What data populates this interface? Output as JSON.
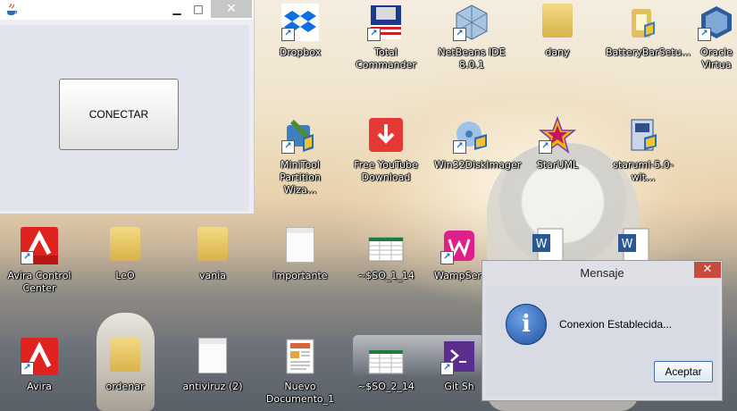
{
  "app_window": {
    "title": "",
    "connect_button": "CONECTAR",
    "controls": {
      "minimize": "▁",
      "maximize": "□",
      "close": "✕"
    }
  },
  "desktop_icons": [
    {
      "label": "Dropbox",
      "icon": "dropbox-icon",
      "color": "#0d6ee6"
    },
    {
      "label": "Total Commander",
      "icon": "total-commander-icon",
      "color": "#c62828"
    },
    {
      "label": "NetBeans IDE 8.0.1",
      "icon": "netbeans-icon",
      "color": "#5c7fa8"
    },
    {
      "label": "dany",
      "icon": "folder-icon",
      "color": "#e2c15a"
    },
    {
      "label": "BatteryBarSetu...",
      "icon": "installer-icon",
      "color": "#3a7ec2"
    },
    {
      "label": "Oracle Virtua",
      "icon": "virtualbox-icon",
      "color": "#2d5c9a"
    },
    {
      "label": "MiniTool Partition Wiza...",
      "icon": "minitool-icon",
      "color": "#4a8c2f"
    },
    {
      "label": "Free YouTube Download",
      "icon": "youtube-download-icon",
      "color": "#e53935"
    },
    {
      "label": "Win32DiskImager",
      "icon": "disk-imager-icon",
      "color": "#3f7fc0"
    },
    {
      "label": "StarUML",
      "icon": "staruml-icon",
      "color": "#f2b705"
    },
    {
      "label": "staruml-5.0-wit...",
      "icon": "installer-icon",
      "color": "#2f4f8f"
    },
    {
      "label": "Avira Control Center",
      "icon": "avira-icon",
      "color": "#e0231f"
    },
    {
      "label": "LeO",
      "icon": "folder-icon",
      "color": "#e2c15a"
    },
    {
      "label": "vania",
      "icon": "folder-icon",
      "color": "#e2c15a"
    },
    {
      "label": "importante",
      "icon": "text-file-icon",
      "color": "#ffffff"
    },
    {
      "label": "~$SO_1_14",
      "icon": "spreadsheet-icon",
      "color": "#1e7a3e"
    },
    {
      "label": "WampServ",
      "icon": "wampserver-icon",
      "color": "#e0208a"
    },
    {
      "label": "Avira",
      "icon": "avira-icon",
      "color": "#e0231f"
    },
    {
      "label": "ordenar",
      "icon": "folder-icon",
      "color": "#e2c15a"
    },
    {
      "label": "antiviruz (2)",
      "icon": "text-file-icon",
      "color": "#ffffff"
    },
    {
      "label": "Nuevo Documento_1",
      "icon": "document-icon",
      "color": "#d9643a"
    },
    {
      "label": "~$SO_2_14",
      "icon": "spreadsheet-icon",
      "color": "#1e7a3e"
    },
    {
      "label": "Git Sh",
      "icon": "git-shell-icon",
      "color": "#5b2d8c"
    }
  ],
  "dialog": {
    "title": "Mensaje",
    "message": "Conexion Establecida...",
    "ok_button": "Aceptar",
    "close": "✕"
  }
}
